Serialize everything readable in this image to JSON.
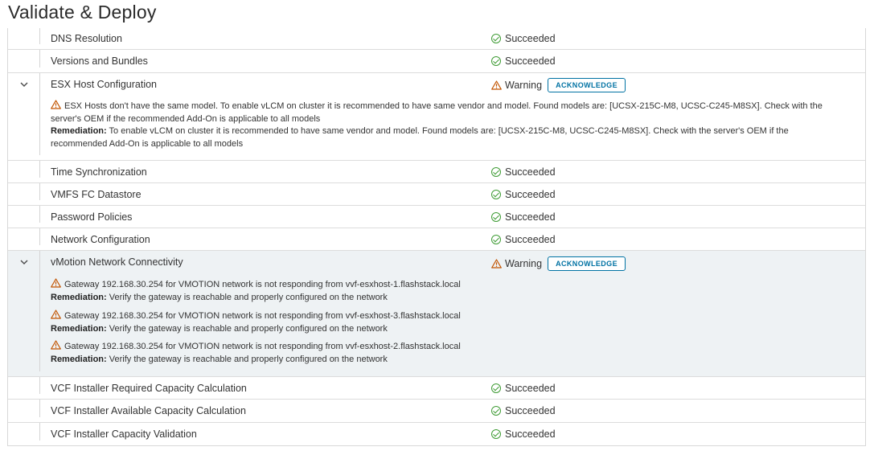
{
  "page": {
    "title": "Validate & Deploy"
  },
  "status_labels": {
    "succeeded": "Succeeded",
    "warning": "Warning"
  },
  "buttons": {
    "acknowledge": "ACKNOWLEDGE"
  },
  "remediation_label": "Remediation:",
  "rows": [
    {
      "name": "DNS Resolution",
      "status": "Succeeded"
    },
    {
      "name": "Versions and Bundles",
      "status": "Succeeded"
    },
    {
      "name": "ESX Host Configuration",
      "status": "Warning",
      "expanded": true,
      "messages": [
        {
          "text": "ESX Hosts don't have the same model. To enable vLCM on cluster it is recommended to have same vendor and model. Found models are: [UCSX-215C-M8, UCSC-C245-M8SX]. Check with the server's OEM if the recommended Add-On is applicable to all models",
          "remediation": "To enable vLCM on cluster it is recommended to have same vendor and model. Found models are: [UCSX-215C-M8, UCSC-C245-M8SX]. Check with the server's OEM if the recommended Add-On is applicable to all models"
        }
      ]
    },
    {
      "name": "Time Synchronization",
      "status": "Succeeded"
    },
    {
      "name": "VMFS FC Datastore",
      "status": "Succeeded"
    },
    {
      "name": "Password Policies",
      "status": "Succeeded"
    },
    {
      "name": "Network Configuration",
      "status": "Succeeded"
    },
    {
      "name": "vMotion Network Connectivity",
      "status": "Warning",
      "expanded": true,
      "messages": [
        {
          "text": "Gateway 192.168.30.254 for VMOTION network is not responding from vvf-esxhost-1.flashstack.local",
          "remediation": "Verify the gateway is reachable and properly configured on the network"
        },
        {
          "text": "Gateway 192.168.30.254 for VMOTION network is not responding from vvf-esxhost-3.flashstack.local",
          "remediation": "Verify the gateway is reachable and properly configured on the network"
        },
        {
          "text": "Gateway 192.168.30.254 for VMOTION network is not responding from vvf-esxhost-2.flashstack.local",
          "remediation": "Verify the gateway is reachable and properly configured on the network"
        }
      ]
    },
    {
      "name": "VCF Installer Required Capacity Calculation",
      "status": "Succeeded"
    },
    {
      "name": "VCF Installer Available Capacity Calculation",
      "status": "Succeeded"
    },
    {
      "name": "VCF Installer Capacity Validation",
      "status": "Succeeded"
    }
  ],
  "colors": {
    "success": "#3f9c35",
    "warning": "#c25400",
    "link": "#0072a3",
    "expanded_bg": "#eef2f4"
  },
  "icons": {
    "success": "check-circle-icon",
    "warning": "warning-triangle-icon",
    "expand": "chevron-down-icon"
  }
}
